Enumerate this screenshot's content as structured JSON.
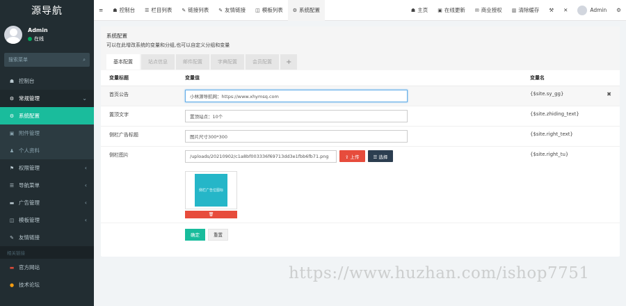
{
  "brand": "源导航",
  "user": {
    "name": "Admin",
    "status": "在线"
  },
  "search": {
    "placeholder": "搜索菜单"
  },
  "sidebar": {
    "items": [
      {
        "icon": "☗",
        "label": "控制台"
      },
      {
        "icon": "⚙",
        "label": "常规管理",
        "caret": "⌄"
      },
      {
        "icon": "⚙",
        "label": "系统配置"
      },
      {
        "icon": "▣",
        "label": "附件管理"
      },
      {
        "icon": "♟",
        "label": "个人资料"
      },
      {
        "icon": "⚑",
        "label": "权限管理",
        "caret": "‹"
      },
      {
        "icon": "☰",
        "label": "导航菜单",
        "caret": "‹"
      },
      {
        "icon": "▬",
        "label": "广告管理",
        "caret": "‹"
      },
      {
        "icon": "◫",
        "label": "模板管理",
        "caret": "‹"
      },
      {
        "icon": "✎",
        "label": "友情链接"
      }
    ],
    "header": "相关链接",
    "links": [
      {
        "icon": "▬",
        "label": "官方网站"
      },
      {
        "icon": "●",
        "label": "技术论坛"
      }
    ]
  },
  "topbar": {
    "menu_icon": "≡",
    "left": [
      {
        "icon": "☗",
        "label": "控制台"
      },
      {
        "icon": "☰",
        "label": "栏目列表"
      },
      {
        "icon": "✎",
        "label": "链接列表"
      },
      {
        "icon": "✎",
        "label": "友情链接"
      },
      {
        "icon": "◫",
        "label": "模板列表"
      },
      {
        "icon": "⚙",
        "label": "系统配置"
      }
    ],
    "right": [
      {
        "icon": "☗",
        "label": "主页"
      },
      {
        "icon": "▣",
        "label": "在线更新"
      },
      {
        "icon": "✉",
        "label": "商业授权"
      },
      {
        "icon": "▥",
        "label": "清除缓存"
      },
      {
        "icon": "⚒",
        "label": ""
      },
      {
        "icon": "✕",
        "label": ""
      }
    ],
    "admin": "Admin",
    "settings_icon": "⚙"
  },
  "panel": {
    "title": "系统配置",
    "desc": "可以在此增改系统的变量和分组,也可以自定义分组和变量",
    "tabs": [
      "基本配置",
      "站点信息",
      "邮件配置",
      "字典配置",
      "会员配置",
      "+"
    ]
  },
  "table": {
    "headers": [
      "变量标题",
      "变量值",
      "变量名"
    ],
    "rows": [
      {
        "label": "首页公告",
        "value": "小林源导航网：https://www.xhymsq.com",
        "var": "{$site.sy_gg}"
      },
      {
        "label": "置顶文字",
        "value": "置顶站点：10个",
        "var": "{$site.zhiding_text}"
      },
      {
        "label": "侧栏广告标题",
        "value": "图片尺寸300*300",
        "var": "{$site.right_text}"
      },
      {
        "label": "侧栏图片",
        "value": "/uploads/20210902/c1a8bf003336f69713dd3e1fbb6fb71.png",
        "var": "{$site.right_tu}"
      }
    ],
    "delete_icon": "✖",
    "upload_label": "⇪ 上传",
    "choose_label": "☰ 选择",
    "thumb_text": "侧栏广告位图标",
    "thumb_delete_icon": "🗑"
  },
  "actions": {
    "ok": "确定",
    "reset": "重置"
  },
  "watermark": "https://www.huzhan.com/ishop7751",
  "colors": {
    "accent": "#1abc9c",
    "sidebar": "#222d32",
    "danger": "#e74c3c"
  }
}
